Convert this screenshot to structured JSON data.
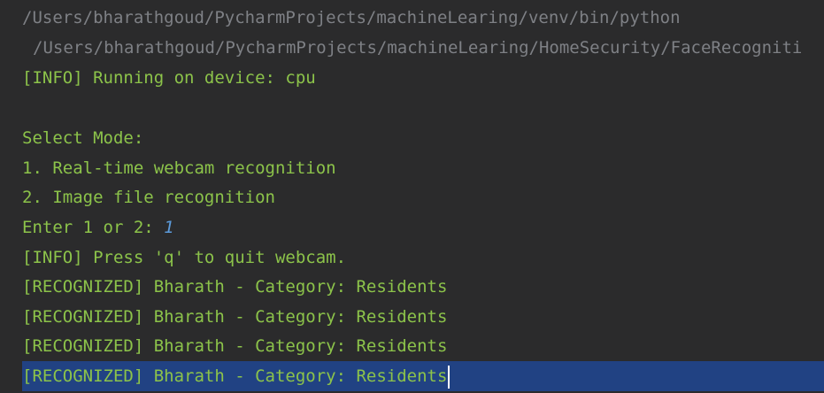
{
  "console": {
    "interpreter_path": "/Users/bharathgoud/PycharmProjects/machineLearing/venv/bin/python",
    "script_path": "/Users/bharathgoud/PycharmProjects/machineLearing/HomeSecurity/FaceRecogniti",
    "info_device": "[INFO] Running on device: cpu",
    "select_mode": "Select Mode:",
    "option_1": "1. Real-time webcam recognition",
    "option_2": "2. Image file recognition",
    "prompt": "Enter 1 or 2: ",
    "prompt_input": "1",
    "info_quit": "[INFO] Press 'q' to quit webcam.",
    "recognized": [
      "[RECOGNIZED] Bharath - Category: Residents",
      "[RECOGNIZED] Bharath - Category: Residents",
      "[RECOGNIZED] Bharath - Category: Residents",
      "[RECOGNIZED] Bharath - Category: Residents"
    ]
  },
  "colors": {
    "background": "#2b2b2c",
    "output_text": "#8cc34a",
    "path_text": "#7e8085",
    "user_input": "#5c9bdb",
    "selection": "#214283"
  }
}
